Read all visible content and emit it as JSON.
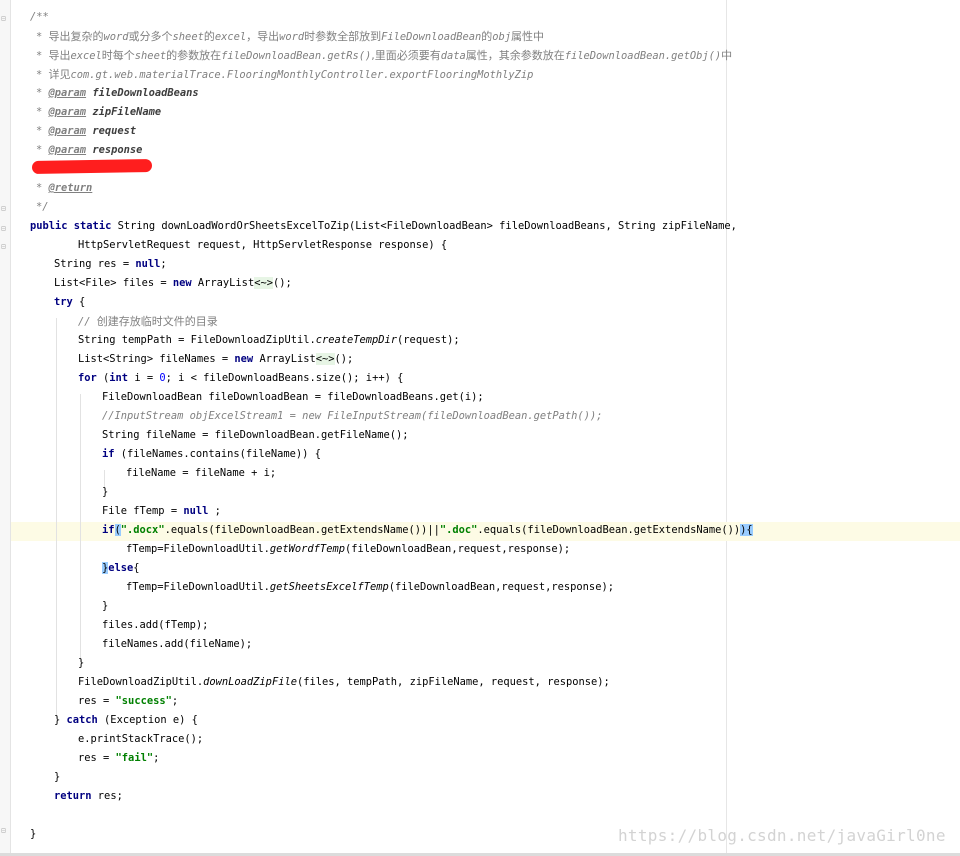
{
  "editor": {
    "watermark": "https://blog.csdn.net/javaGirl0ne"
  },
  "code": {
    "doc_open": "/**",
    "doc1_a": "导出复杂的",
    "doc1_b": "word",
    "doc1_c": "或分多个",
    "doc1_d": "sheet",
    "doc1_e": "的",
    "doc1_f": "excel",
    "doc1_g": "，导出",
    "doc1_h": "word",
    "doc1_i": "时参数全部放到",
    "doc1_j": "FileDownloadBean",
    "doc1_k": "的",
    "doc1_l": "obj",
    "doc1_m": "属性中",
    "doc2_a": "导出",
    "doc2_b": "excel",
    "doc2_c": "时每个",
    "doc2_d": "sheet",
    "doc2_e": "的参数放在",
    "doc2_f": "fileDownloadBean.getRs()",
    "doc2_g": ",里面必须要有",
    "doc2_h": "data",
    "doc2_i": "属性，其余参数放在",
    "doc2_j": "fileDownloadBean.getObj()",
    "doc2_k": "中",
    "doc3_a": "详见",
    "doc3_b": "com.gt.web.materialTrace.FlooringMonthlyController.exportFlooringMothlyZip",
    "param_tag": "@param",
    "param1": "fileDownloadBeans",
    "param2": "zipFileName",
    "param3": "request",
    "param4": "response",
    "return_tag": "@return",
    "doc_close": "*/",
    "sig1_kw": "public static",
    "sig1_rest": " String downLoadWordOrSheetsExcelToZip(List<FileDownloadBean> fileDownloadBeans, String zipFileName,",
    "sig2": "HttpServletRequest request, HttpServletResponse response) {",
    "l_res_a": "String res = ",
    "l_null": "null",
    "l_res_b": ";",
    "l_files_a": "List<File> files = ",
    "l_new": "new",
    "l_files_b": " ArrayList",
    "l_diamond": "<~>",
    "l_files_c": "();",
    "l_try": "try",
    "l_try_b": " {",
    "l_cm1_a": "// ",
    "l_cm1_b": "创建存放临时文件的目录",
    "l_temp_a": "String tempPath = FileDownloadZipUtil.",
    "l_temp_m": "createTempDir",
    "l_temp_b": "(request);",
    "l_names_a": "List<String> fileNames = ",
    "l_names_b": " ArrayList",
    "l_names_c": "();",
    "l_for": "for",
    "l_for_b": " (",
    "l_int": "int",
    "l_for_c": " i = ",
    "l_zero": "0",
    "l_for_d": "; i < fileDownloadBeans.size(); i++) {",
    "l_bean": "FileDownloadBean fileDownloadBean = fileDownloadBeans.get(i);",
    "l_cm2": "//InputStream objExcelStream1 = new FileInputStream(fileDownloadBean.getPath());",
    "l_fname": "String fileName = fileDownloadBean.getFileName();",
    "l_if": "if",
    "l_if_b": " (fileNames.contains(fileName)) {",
    "l_fname2": "fileName = fileName + i;",
    "l_close": "}",
    "l_ftemp_a": "File fTemp = ",
    "l_ftemp_b": " ;",
    "l_if2_a": "(",
    "l_docx": "\".docx\"",
    "l_if2_b": ".equals(fileDownloadBean.getExtendsName())||",
    "l_doc": "\".doc\"",
    "l_if2_c": ".equals(fileDownloadBean.getExtendsName())",
    "l_if2_d": ")",
    "l_if2_e": "{",
    "l_word_a": "fTemp=FileDownloadUtil.",
    "l_word_m": "getWordfTemp",
    "l_word_b": "(fileDownloadBean,request,response);",
    "l_else_a": "}",
    "l_else": "else",
    "l_else_b": "{",
    "l_excel_a": "fTemp=FileDownloadUtil.",
    "l_excel_m": "getSheetsExcelfTemp",
    "l_excel_b": "(fileDownloadBean,request,response);",
    "l_add1": "files.add(fTemp);",
    "l_add2": "fileNames.add(fileName);",
    "l_zip_a": "FileDownloadZipUtil.",
    "l_zip_m": "downLoadZipFile",
    "l_zip_b": "(files, tempPath, zipFileName, request, response);",
    "l_res2_a": "res = ",
    "l_success": "\"success\"",
    "l_semi": ";",
    "l_catch_a": "} ",
    "l_catch": "catch",
    "l_catch_b": " (Exception e) {",
    "l_print": "e.printStackTrace();",
    "l_fail": "\"fail\"",
    "l_return": "return",
    "l_return_b": " res;",
    "l_end": "}"
  }
}
